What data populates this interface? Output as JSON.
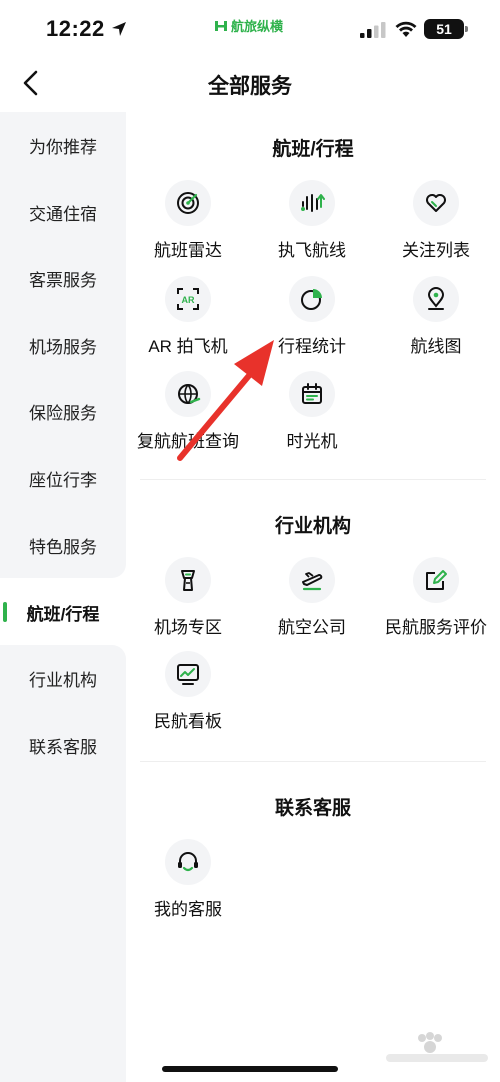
{
  "status_bar": {
    "time": "12:22",
    "brand": "航旅纵横",
    "battery": "51"
  },
  "header": {
    "title": "全部服务"
  },
  "sidebar": {
    "items": [
      {
        "label": "为你推荐"
      },
      {
        "label": "交通住宿"
      },
      {
        "label": "客票服务"
      },
      {
        "label": "机场服务"
      },
      {
        "label": "保险服务"
      },
      {
        "label": "座位行李"
      },
      {
        "label": "特色服务"
      },
      {
        "label": "航班/行程",
        "active": true
      },
      {
        "label": "行业机构"
      },
      {
        "label": "联系客服"
      }
    ]
  },
  "sections": [
    {
      "title": "航班/行程",
      "services": [
        {
          "label": "航班雷达",
          "icon": "radar-icon"
        },
        {
          "label": "执飞航线",
          "icon": "route-icon"
        },
        {
          "label": "关注列表",
          "icon": "heart-icon"
        },
        {
          "label": "AR 拍飞机",
          "icon": "ar-icon"
        },
        {
          "label": "行程统计",
          "icon": "pie-chart-icon"
        },
        {
          "label": "航线图",
          "icon": "map-pin-icon"
        },
        {
          "label": "复航航班查询",
          "icon": "globe-icon"
        },
        {
          "label": "时光机",
          "icon": "calendar-icon"
        }
      ]
    },
    {
      "title": "行业机构",
      "services": [
        {
          "label": "机场专区",
          "icon": "control-tower-icon"
        },
        {
          "label": "航空公司",
          "icon": "airplane-icon"
        },
        {
          "label": "民航服务评价",
          "icon": "edit-icon"
        },
        {
          "label": "民航看板",
          "icon": "dashboard-icon"
        }
      ]
    },
    {
      "title": "联系客服",
      "services": [
        {
          "label": "我的客服",
          "icon": "headset-icon"
        }
      ]
    }
  ],
  "colors": {
    "accent": "#2fb24c",
    "sidebar_bg": "#f4f5f7",
    "icon_bg": "#f3f4f6",
    "annotation_arrow": "#e8322b"
  }
}
